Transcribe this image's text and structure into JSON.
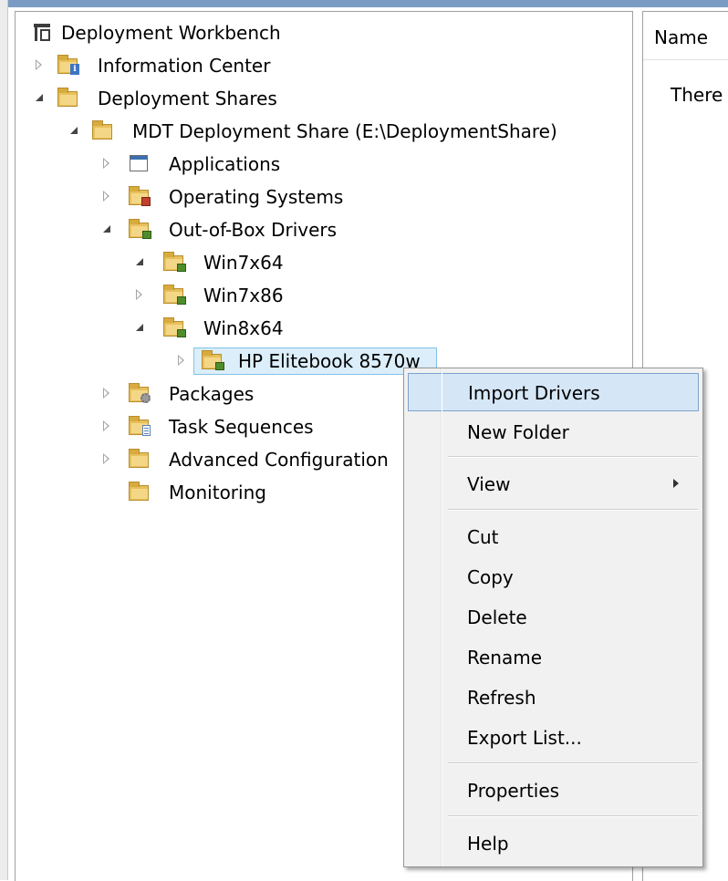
{
  "list": {
    "column_header": "Name",
    "empty_text": "There"
  },
  "tree": {
    "root": "Deployment Workbench",
    "information_center": "Information Center",
    "deployment_shares": "Deployment Shares",
    "share": "MDT Deployment Share (E:\\DeploymentShare)",
    "applications": "Applications",
    "operating_systems": "Operating Systems",
    "out_of_box_drivers": "Out-of-Box Drivers",
    "win7x64": "Win7x64",
    "win7x86": "Win7x86",
    "win8x64": "Win8x64",
    "hp_elitebook": "HP Elitebook 8570w",
    "packages": "Packages",
    "task_sequences": "Task Sequences",
    "advanced_configuration": "Advanced Configuration",
    "monitoring": "Monitoring"
  },
  "context_menu": {
    "import_drivers": "Import Drivers",
    "new_folder": "New Folder",
    "view": "View",
    "cut": "Cut",
    "copy": "Copy",
    "delete": "Delete",
    "rename": "Rename",
    "refresh": "Refresh",
    "export_list": "Export List...",
    "properties": "Properties",
    "help": "Help"
  },
  "colors": {
    "selection": "#dbeefa",
    "menu_highlight": "#d5e6f7",
    "folder": "#e7c05c"
  }
}
